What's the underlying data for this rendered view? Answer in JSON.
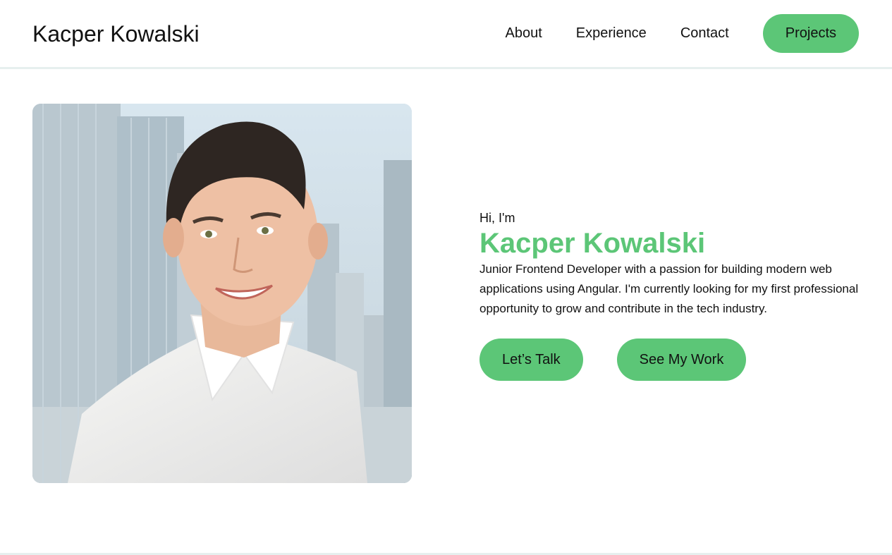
{
  "header": {
    "brand": "Kacper Kowalski",
    "nav": {
      "about": "About",
      "experience": "Experience",
      "contact": "Contact",
      "projects": "Projects"
    }
  },
  "hero": {
    "greeting": "Hi, I'm",
    "name": "Kacper Kowalski",
    "bio": "Junior Frontend Developer with a passion for building modern web applications using Angular. I'm currently looking for my first professional opportunity to grow and contribute in the tech industry.",
    "buttons": {
      "talk": "Let’s Talk",
      "work": "See My Work"
    }
  },
  "colors": {
    "accent": "#5cc677",
    "divider": "#e6efee",
    "text": "#111111"
  }
}
